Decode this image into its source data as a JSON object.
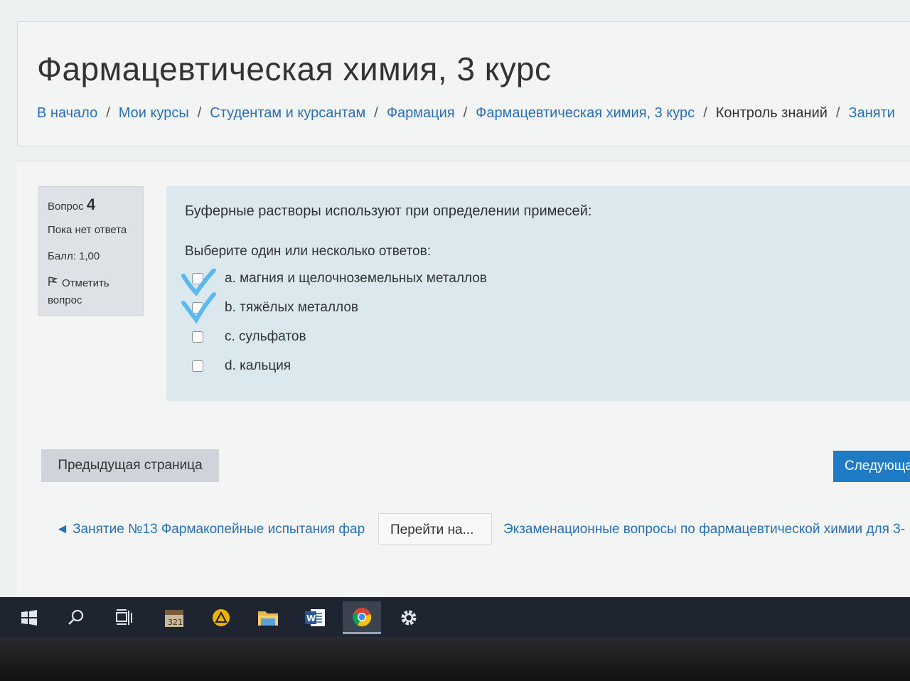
{
  "course_title": "Фармацевтическая химия, 3 курс",
  "breadcrumb": [
    {
      "label": "В начало",
      "current": false
    },
    {
      "label": "Мои курсы",
      "current": false
    },
    {
      "label": "Студентам и курсантам",
      "current": false
    },
    {
      "label": "Фармация",
      "current": false
    },
    {
      "label": "Фармацевтическая химия, 3 курс",
      "current": false
    },
    {
      "label": "Контроль знаний",
      "current": true
    },
    {
      "label": "Заняти",
      "current": false
    }
  ],
  "question_info": {
    "label": "Вопрос",
    "number": "4",
    "state": "Пока нет ответа",
    "grade": "Балл: 1,00",
    "flag_label": "Отметить вопрос"
  },
  "question": {
    "text": "Буферные растворы используют при определении примесей:",
    "prompt": "Выберите один или несколько ответов:",
    "answers": [
      {
        "label": "a. магния и щелочноземельных металлов",
        "hand_checked": true
      },
      {
        "label": "b. тяжёлых металлов",
        "hand_checked": true
      },
      {
        "label": "c. сульфатов",
        "hand_checked": false
      },
      {
        "label": "d. кальция",
        "hand_checked": false
      }
    ]
  },
  "buttons": {
    "prev": "Предыдущая страница",
    "next": "Следующа"
  },
  "activity_nav": {
    "prev_link": "◄ Занятие №13 Фармакопейные испытания фар",
    "jump_placeholder": "Перейти на...",
    "next_link": "Экзаменационные вопросы по фармацевтической химии для 3-"
  },
  "taskbar": {
    "items": [
      "windows-start",
      "search",
      "task-view",
      "calendar-app",
      "warning-app",
      "file-explorer",
      "word",
      "chrome",
      "settings"
    ],
    "active": "chrome"
  },
  "colors": {
    "link": "#2a6fb5",
    "question_bg": "#dbe9ef",
    "info_bg": "#dee2e6",
    "next_button": "#1f7bc4",
    "handwritten_check": "#5bb8f0"
  }
}
